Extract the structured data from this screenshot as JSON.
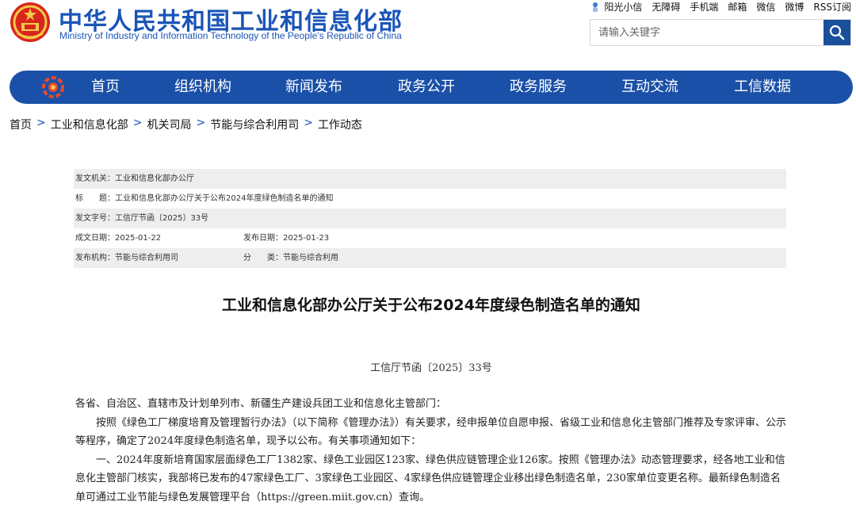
{
  "header": {
    "title_cn": "中华人民共和国工业和信息化部",
    "title_en": "Ministry of Industry and Information Technology of the People’s Republic of China",
    "top_links": [
      "阳光小信",
      "无障碍",
      "手机端",
      "邮箱",
      "微信",
      "微博",
      "RSS订阅"
    ],
    "search_placeholder": "请输入关键字"
  },
  "nav": {
    "items": [
      "首页",
      "组织机构",
      "新闻发布",
      "政务公开",
      "政务服务",
      "互动交流",
      "工信数据"
    ]
  },
  "breadcrumb": [
    "首页",
    "工业和信息化部",
    "机关司局",
    "节能与综合利用司",
    "工作动态"
  ],
  "meta": {
    "issuer_label": "发文机关：",
    "issuer": "工业和信息化部办公厅",
    "title_label": "标　　题：",
    "title": "工业和信息化部办公厅关于公布2024年度绿色制造名单的通知",
    "docno_label": "发文字号：",
    "docno": "工信厅节函〔2025〕33号",
    "created_label": "成文日期：",
    "created": "2025-01-22",
    "published_label": "发布日期：",
    "published": "2025-01-23",
    "org_label": "发布机构：",
    "org": "节能与综合利用司",
    "category_label": "分　　类：",
    "category": "节能与综合利用"
  },
  "article": {
    "title": "工业和信息化部办公厅关于公布2024年度绿色制造名单的通知",
    "doc_no": "工信厅节函〔2025〕33号",
    "salutation": "各省、自治区、直辖市及计划单列市、新疆生产建设兵团工业和信息化主管部门：",
    "p1": "按照《绿色工厂梯度培育及管理暂行办法》（以下简称《管理办法》）有关要求，经申报单位自愿申报、省级工业和信息化主管部门推荐及专家评审、公示等程序，确定了2024年度绿色制造名单，现予以公布。有关事项通知如下：",
    "p2": "一、2024年度新培育国家层面绿色工厂1382家、绿色工业园区123家、绿色供应链管理企业126家。按照《管理办法》动态管理要求，经各地工业和信息化主管部门核实，我部将已发布的47家绿色工厂、3家绿色工业园区、4家绿色供应链管理企业移出绿色制造名单，230家单位变更名称。最新绿色制造名单可通过工业节能与绿色发展管理平台（https://green.miit.gov.cn）查询。"
  },
  "colors": {
    "brand_blue": "#1b50a8",
    "meta_shade": "#eeeeee"
  }
}
